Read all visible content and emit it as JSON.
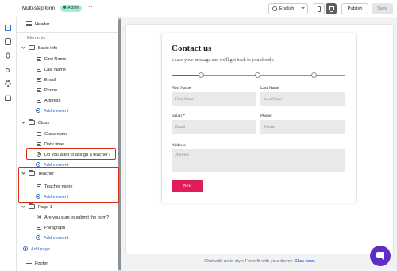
{
  "topbar": {
    "title": "Multi-step form",
    "status_badge": "Active",
    "more_label": "···",
    "language": "English",
    "publish_label": "Publish",
    "save_label": "Save"
  },
  "sidebar": {
    "header_label": "Header",
    "elements_label": "Elements",
    "groups": [
      {
        "label": "Basic info",
        "items": [
          "First Name",
          "Last Name",
          "Email",
          "Phone",
          "Address"
        ],
        "add_label": "Add element"
      },
      {
        "label": "Class",
        "items": [
          "Class name",
          "Date time",
          "Do you want to assign a teacher?"
        ],
        "add_label": "Add element"
      },
      {
        "label": "Teacher",
        "items": [
          "Teacher name"
        ],
        "add_label": "Add element"
      },
      {
        "label": "Page 1",
        "items": [
          "Are you sure to submit the form?",
          "Paragraph"
        ],
        "add_label": "Add element"
      }
    ],
    "add_page_label": "Add page",
    "footer_label": "Footer"
  },
  "form": {
    "title": "Contact us",
    "subtitle": "Leave your message and we'll get back to you shortly.",
    "progress": 0.17,
    "fields": {
      "first_name_label": "First Name",
      "first_name_placeholder": "First Name",
      "last_name_label": "Last Name",
      "last_name_placeholder": "Last Name",
      "email_label": "Email *",
      "email_placeholder": "Email",
      "phone_label": "Phone",
      "phone_placeholder": "Phone",
      "address_label": "Address",
      "address_placeholder": "Address"
    },
    "next_label": "Next"
  },
  "footer_note": {
    "text": "Chat with us to style Form fit with your theme",
    "link": "Chat now."
  },
  "colors": {
    "accent": "#2c6ecb",
    "highlight": "#d72c0d",
    "brand_button": "#e01c5a",
    "chat": "#5a2fc2"
  }
}
